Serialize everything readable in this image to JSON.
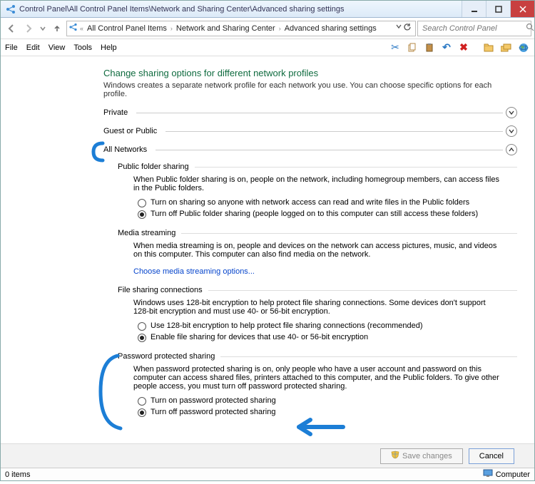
{
  "window": {
    "title": "Control Panel\\All Control Panel Items\\Network and Sharing Center\\Advanced sharing settings"
  },
  "breadcrumb": {
    "items": [
      "All Control Panel Items",
      "Network and Sharing Center",
      "Advanced sharing settings"
    ]
  },
  "search": {
    "placeholder": "Search Control Panel"
  },
  "menu": {
    "file": "File",
    "edit": "Edit",
    "view": "View",
    "tools": "Tools",
    "help": "Help"
  },
  "heading": "Change sharing options for different network profiles",
  "heading_desc": "Windows creates a separate network profile for each network you use. You can choose specific options for each profile.",
  "sections": {
    "private": {
      "label": "Private"
    },
    "guest": {
      "label": "Guest or Public"
    },
    "allnet": {
      "label": "All Networks"
    }
  },
  "pfs": {
    "title": "Public folder sharing",
    "desc": "When Public folder sharing is on, people on the network, including homegroup members, can access files in the Public folders.",
    "opt1": "Turn on sharing so anyone with network access can read and write files in the Public folders",
    "opt2": "Turn off Public folder sharing (people logged on to this computer can still access these folders)"
  },
  "media": {
    "title": "Media streaming",
    "desc": "When media streaming is on, people and devices on the network can access pictures, music, and videos on this computer. This computer can also find media on the network.",
    "link": "Choose media streaming options..."
  },
  "fsc": {
    "title": "File sharing connections",
    "desc": "Windows uses 128-bit encryption to help protect file sharing connections. Some devices don't support 128-bit encryption and must use 40- or 56-bit encryption.",
    "opt1": "Use 128-bit encryption to help protect file sharing connections (recommended)",
    "opt2": "Enable file sharing for devices that use 40- or 56-bit encryption"
  },
  "pps": {
    "title": "Password protected sharing",
    "desc": "When password protected sharing is on, only people who have a user account and password on this computer can access shared files, printers attached to this computer, and the Public folders. To give other people access, you must turn off password protected sharing.",
    "opt1": "Turn on password protected sharing",
    "opt2": "Turn off password protected sharing"
  },
  "buttons": {
    "save": "Save changes",
    "cancel": "Cancel"
  },
  "status": {
    "left": "0 items",
    "right": "Computer"
  }
}
